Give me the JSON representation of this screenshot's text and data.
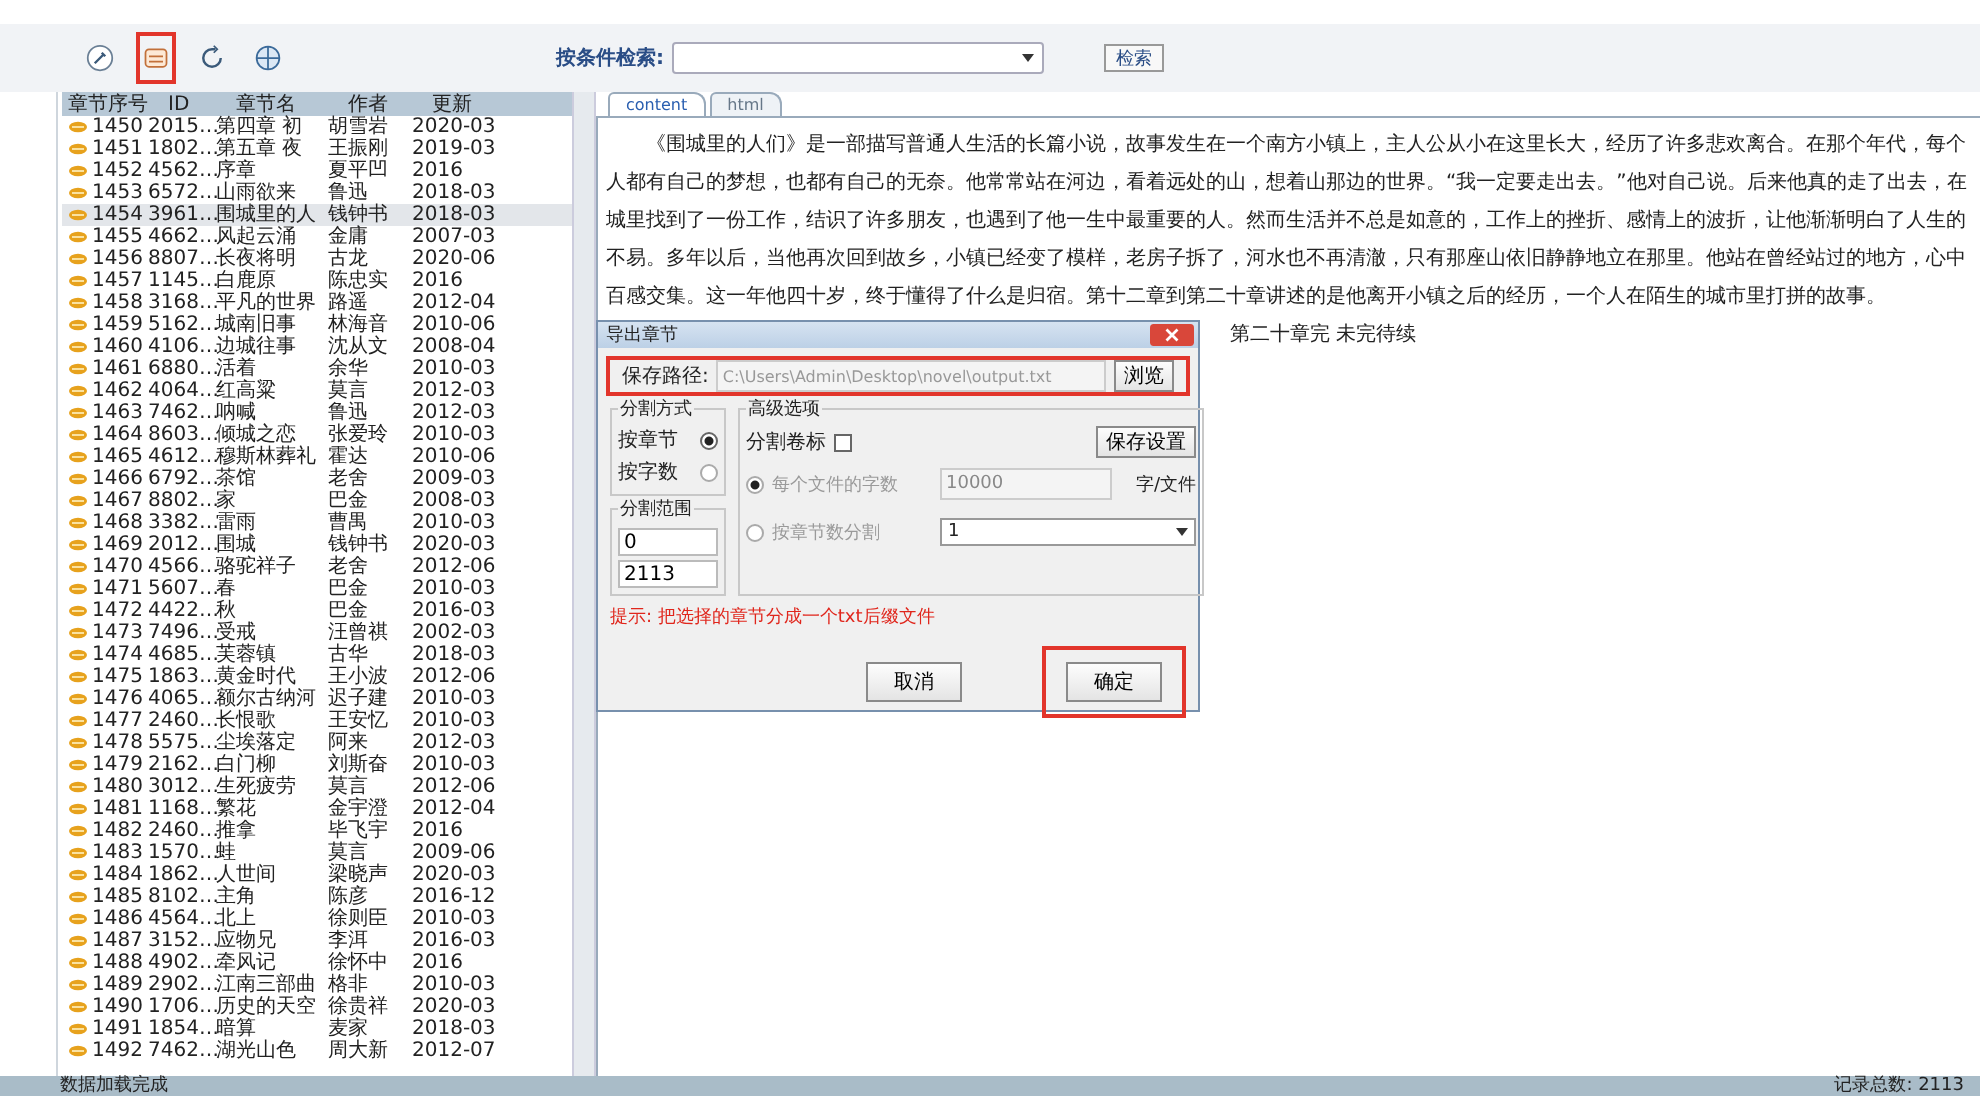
{
  "toolbar": {
    "buttons": [
      {
        "highlighted": false
      },
      {
        "highlighted": true
      },
      {
        "highlighted": false
      },
      {
        "highlighted": false
      }
    ],
    "search_label": "按条件检索:",
    "search_button": "检索"
  },
  "table": {
    "columns": [
      "章节序号",
      "ID",
      "章节名",
      "作者",
      "更新"
    ],
    "rows": [
      {
        "cells": [
          "1450",
          "2015…",
          "第四章 初",
          "胡雪岩",
          "2020-03"
        ],
        "selected": false
      },
      {
        "cells": [
          "1451",
          "1802…",
          "第五章 夜",
          "王振刚",
          "2019-03"
        ],
        "selected": false
      },
      {
        "cells": [
          "1452",
          "4562…",
          "序章",
          "夏平凹",
          "2016"
        ],
        "selected": false
      },
      {
        "cells": [
          "1453",
          "6572…",
          "山雨欲来",
          "鲁迅",
          "2018-03"
        ],
        "selected": false
      },
      {
        "cells": [
          "1454",
          "3961…",
          "围城里的人",
          "钱钟书",
          "2018-03"
        ],
        "selected": true
      },
      {
        "cells": [
          "1455",
          "4662…",
          "风起云涌",
          "金庸",
          "2007-03"
        ],
        "selected": false
      },
      {
        "cells": [
          "1456",
          "8807…",
          "长夜将明",
          "古龙",
          "2020-06"
        ],
        "selected": false
      },
      {
        "cells": [
          "1457",
          "1145…",
          "白鹿原",
          "陈忠实",
          "2016"
        ],
        "selected": false
      },
      {
        "cells": [
          "1458",
          "3168…",
          "平凡的世界",
          "路遥",
          "2012-04"
        ],
        "selected": false
      },
      {
        "cells": [
          "1459",
          "5162…",
          "城南旧事",
          "林海音",
          "2010-06"
        ],
        "selected": false
      },
      {
        "cells": [
          "1460",
          "4106…",
          "边城往事",
          "沈从文",
          "2008-04"
        ],
        "selected": false
      },
      {
        "cells": [
          "1461",
          "6880…",
          "活着",
          "余华",
          "2010-03"
        ],
        "selected": false
      },
      {
        "cells": [
          "1462",
          "4064…",
          "红高粱",
          "莫言",
          "2012-03"
        ],
        "selected": false
      },
      {
        "cells": [
          "1463",
          "7462…",
          "呐喊",
          "鲁迅",
          "2012-03"
        ],
        "selected": false
      },
      {
        "cells": [
          "1464",
          "8603…",
          "倾城之恋",
          "张爱玲",
          "2010-03"
        ],
        "selected": false
      },
      {
        "cells": [
          "1465",
          "4612…",
          "穆斯林葬礼",
          "霍达",
          "2010-06"
        ],
        "selected": false
      },
      {
        "cells": [
          "1466",
          "6792…",
          "茶馆",
          "老舍",
          "2009-03"
        ],
        "selected": false
      },
      {
        "cells": [
          "1467",
          "8802…",
          "家",
          "巴金",
          "2008-03"
        ],
        "selected": false
      },
      {
        "cells": [
          "1468",
          "3382…",
          "雷雨",
          "曹禺",
          "2010-03"
        ],
        "selected": false
      },
      {
        "cells": [
          "1469",
          "2012…",
          "围城",
          "钱钟书",
          "2020-03"
        ],
        "selected": false
      },
      {
        "cells": [
          "1470",
          "4566…",
          "骆驼祥子",
          "老舍",
          "2012-06"
        ],
        "selected": false
      },
      {
        "cells": [
          "1471",
          "5607…",
          "春",
          "巴金",
          "2010-03"
        ],
        "selected": false
      },
      {
        "cells": [
          "1472",
          "4422…",
          "秋",
          "巴金",
          "2016-03"
        ],
        "selected": false
      },
      {
        "cells": [
          "1473",
          "7496…",
          "受戒",
          "汪曾祺",
          "2002-03"
        ],
        "selected": false
      },
      {
        "cells": [
          "1474",
          "4685…",
          "芙蓉镇",
          "古华",
          "2018-03"
        ],
        "selected": false
      },
      {
        "cells": [
          "1475",
          "1863…",
          "黄金时代",
          "王小波",
          "2012-06"
        ],
        "selected": false
      },
      {
        "cells": [
          "1476",
          "4065…",
          "额尔古纳河",
          "迟子建",
          "2010-03"
        ],
        "selected": false
      },
      {
        "cells": [
          "1477",
          "2460…",
          "长恨歌",
          "王安忆",
          "2010-03"
        ],
        "selected": false
      },
      {
        "cells": [
          "1478",
          "5575…",
          "尘埃落定",
          "阿来",
          "2012-03"
        ],
        "selected": false
      },
      {
        "cells": [
          "1479",
          "2162…",
          "白门柳",
          "刘斯奋",
          "2010-03"
        ],
        "selected": false
      },
      {
        "cells": [
          "1480",
          "3012…",
          "生死疲劳",
          "莫言",
          "2012-06"
        ],
        "selected": false
      },
      {
        "cells": [
          "1481",
          "1168…",
          "繁花",
          "金宇澄",
          "2012-04"
        ],
        "selected": false
      },
      {
        "cells": [
          "1482",
          "2460…",
          "推拿",
          "毕飞宇",
          "2016"
        ],
        "selected": false
      },
      {
        "cells": [
          "1483",
          "1570…",
          "蛙",
          "莫言",
          "2009-06"
        ],
        "selected": false
      },
      {
        "cells": [
          "1484",
          "1862…",
          "人世间",
          "梁晓声",
          "2020-03"
        ],
        "selected": false
      },
      {
        "cells": [
          "1485",
          "8102…",
          "主角",
          "陈彦",
          "2016-12"
        ],
        "selected": false
      },
      {
        "cells": [
          "1486",
          "4564…",
          "北上",
          "徐则臣",
          "2010-03"
        ],
        "selected": false
      },
      {
        "cells": [
          "1487",
          "3152…",
          "应物兄",
          "李洱",
          "2016-03"
        ],
        "selected": false
      },
      {
        "cells": [
          "1488",
          "4902…",
          "牵风记",
          "徐怀中",
          "2016"
        ],
        "selected": false
      },
      {
        "cells": [
          "1489",
          "2902…",
          "江南三部曲",
          "格非",
          "2010-03"
        ],
        "selected": false
      },
      {
        "cells": [
          "1490",
          "1706…",
          "历史的天空",
          "徐贵祥",
          "2020-03"
        ],
        "selected": false
      },
      {
        "cells": [
          "1491",
          "1854…",
          "暗算",
          "麦家",
          "2018-03"
        ],
        "selected": false
      },
      {
        "cells": [
          "1492",
          "7462…",
          "湖光山色",
          "周大新",
          "2012-07"
        ],
        "selected": false
      }
    ]
  },
  "tabs": [
    {
      "label": "content",
      "selected": true
    },
    {
      "label": "html",
      "selected": false
    }
  ],
  "text": {
    "paragraph": "《围城里的人们》是一部描写普通人生活的长篇小说，故事发生在一个南方小镇上，主人公从小在这里长大，经历了许多悲欢离合。在那个年代，每个人都有自己的梦想，也都有自己的无奈。他常常站在河边，看着远处的山，想着山那边的世界。“我一定要走出去。”他对自己说。后来他真的走了出去，在城里找到了一份工作，结识了许多朋友，也遇到了他一生中最重要的人。然而生活并不总是如意的，工作上的挫折、感情上的波折，让他渐渐明白了人生的不易。多年以后，当他再次回到故乡，小镇已经变了模样，老房子拆了，河水也不再清澈，只有那座山依旧静静地立在那里。他站在曾经站过的地方，心中百感交集。这一年他四十岁，终于懂得了什么是归宿。第十二章到第二十章讲述的是他离开小镇之后的经历，一个人在陌生的城市里打拼的故事。",
    "tail": "第二十章完 未完待续"
  },
  "dialog": {
    "title": "导出章节",
    "path_label": "保存路径:",
    "path_value": "C:\\Users\\Admin\\Desktop\\novel\\output.txt",
    "path_highlighted": true,
    "browse_button": "浏览",
    "mode_group": "分割方式",
    "modes": [
      {
        "label": "按章节",
        "selected": true
      },
      {
        "label": "按字数",
        "selected": false
      }
    ],
    "range_group": "分割范围",
    "range_from": "0",
    "range_to": "2113",
    "advanced_group": "高级选项",
    "volume": {
      "label": "分割卷标",
      "checked": false
    },
    "save_settings": "保存设置",
    "options": [
      {
        "kind": "input",
        "label": "每个文件的字数",
        "selected": true,
        "disabled": true,
        "value": "10000",
        "unit": "字/文件"
      },
      {
        "kind": "select",
        "label": "按章节数分割",
        "selected": false,
        "disabled": true,
        "value": "1"
      }
    ],
    "note": "提示: 把选择的章节分成一个txt后缀文件",
    "cancel_button": "取消",
    "ok_button": "确定",
    "ok_highlighted": true
  },
  "status_bar": {
    "left": "数据加载完成",
    "right": "记录总数: 2113"
  }
}
